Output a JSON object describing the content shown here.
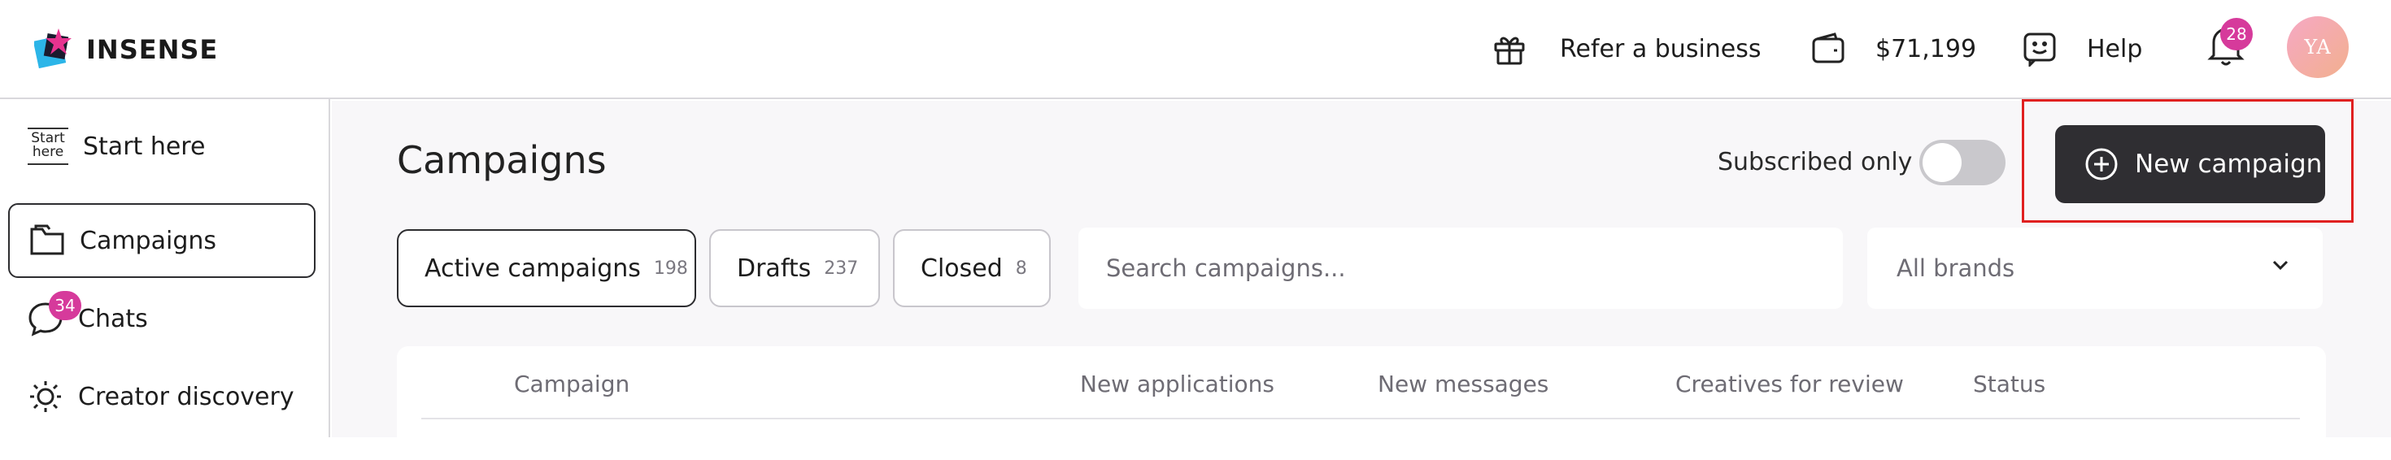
{
  "header": {
    "logo_text": "INSENSE",
    "refer_label": "Refer a business",
    "balance": "$71,199",
    "help_label": "Help",
    "notification_count": "28",
    "avatar_initials": "YA"
  },
  "sidebar": {
    "items": [
      {
        "label": "Start here",
        "icon_text_1": "Start",
        "icon_text_2": "here"
      },
      {
        "label": "Campaigns"
      },
      {
        "label": "Chats",
        "badge": "34"
      },
      {
        "label": "Creator discovery"
      }
    ]
  },
  "main": {
    "title": "Campaigns",
    "subscribed_label": "Subscribed only",
    "subscribed_on": false,
    "new_campaign_label": "New campaign",
    "tabs": [
      {
        "label": "Active campaigns",
        "count": "198"
      },
      {
        "label": "Drafts",
        "count": "237"
      },
      {
        "label": "Closed",
        "count": "8"
      }
    ],
    "search_placeholder": "Search campaigns...",
    "brand_filter": "All brands",
    "table_columns": [
      "Campaign",
      "New applications",
      "New messages",
      "Creatives for review",
      "Status"
    ]
  },
  "colors": {
    "badge": "#d63a9b",
    "button_dark": "#2f2e32",
    "highlight": "#e02020",
    "main_bg": "#f8f7f9"
  },
  "icons": [
    "gift-icon",
    "wallet-icon",
    "help-smiley-icon",
    "bell-icon",
    "folder-icon",
    "chat-icon",
    "discovery-icon",
    "plus-circle-icon",
    "chevron-down-icon"
  ]
}
